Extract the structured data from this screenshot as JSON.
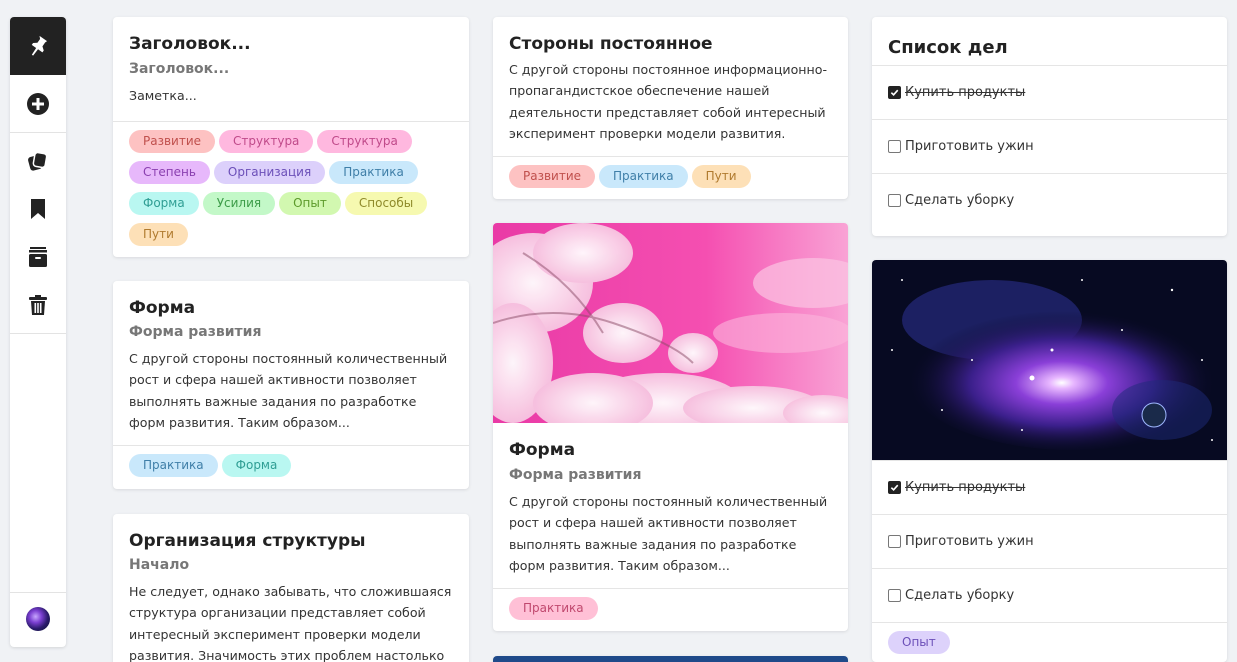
{
  "sidebar": {
    "items": [
      {
        "icon": "pin-icon",
        "active": true
      },
      {
        "icon": "add-circle-icon"
      },
      {
        "icon": "notes-icon"
      },
      {
        "icon": "bookmark-icon"
      },
      {
        "icon": "archive-icon"
      },
      {
        "icon": "trash-icon"
      }
    ]
  },
  "col1": {
    "card1": {
      "title": "Заголовок...",
      "subtitle": "Заголовок...",
      "text": "Заметка...",
      "tags": [
        "Развитие",
        "Структура",
        "Структура",
        "Степень",
        "Организация",
        "Практика",
        "Форма",
        "Усилия",
        "Опыт",
        "Способы",
        "Пути"
      ]
    },
    "card2": {
      "title": "Форма",
      "subtitle": "Форма развития",
      "text": "С другой стороны постоянный количественный рост и сфера нашей активности позволяет выполнять важные задания по разработке форм развития. Таким образом...",
      "tags": [
        "Практика",
        "Форма"
      ]
    },
    "card3": {
      "title": "Организация структуры",
      "subtitle": "Начало",
      "text": "Не следует, однако забывать, что сложившаяся структура организации представляет собой интересный эксперимент проверки модели развития. Значимость этих проблем настолько"
    }
  },
  "col2": {
    "card1": {
      "title": "Стороны постоянное",
      "text": "С другой стороны постоянное информационно-пропагандистское обеспечение нашей деятельности представляет собой интересный эксперимент проверки модели развития.",
      "tags": [
        "Развитие",
        "Практика",
        "Пути"
      ]
    },
    "card2": {
      "title": "Форма",
      "subtitle": "Форма развития",
      "text": "С другой стороны постоянный количественный рост и сфера нашей активности позволяет выполнять важные задания по разработке форм развития. Таким образом...",
      "tags": [
        "Практика"
      ]
    }
  },
  "col3": {
    "todo1": {
      "title": "Список дел",
      "items": [
        {
          "label": "Купить продукты",
          "checked": true
        },
        {
          "label": "Приготовить ужин",
          "checked": false
        },
        {
          "label": "Сделать уборку",
          "checked": false
        }
      ]
    },
    "todo2": {
      "items": [
        {
          "label": "Купить продукты",
          "checked": true
        },
        {
          "label": "Приготовить ужин",
          "checked": false
        },
        {
          "label": "Сделать уборку",
          "checked": false
        }
      ],
      "tags": [
        "Опыт"
      ]
    }
  },
  "tag_colors": {
    "Развитие": [
      "#fdc2c2",
      "#c0504d"
    ],
    "Структура": [
      "#ffb8df",
      "#c04a8a"
    ],
    "Степень": [
      "#e7b8fb",
      "#8a3fb0"
    ],
    "Организация": [
      "#dcd0fb",
      "#6b4fb8"
    ],
    "Практика": [
      "#c9e8fb",
      "#3f7fa8"
    ],
    "Форма": [
      "#b9f7f1",
      "#2f9e94"
    ],
    "Усилия": [
      "#c3f8c8",
      "#3c9c48"
    ],
    "Опыт_col1": [
      "#d2f8b0",
      "#5c9a2a"
    ],
    "Способы": [
      "#f6f9b0",
      "#8f8a2a"
    ],
    "Пути": [
      "#fde0b7",
      "#b07a2e"
    ],
    "Практика_pink": [
      "#ffc0d6",
      "#c0486e"
    ],
    "Опыт_purple": [
      "#ddd2fb",
      "#6b4fb8"
    ]
  }
}
